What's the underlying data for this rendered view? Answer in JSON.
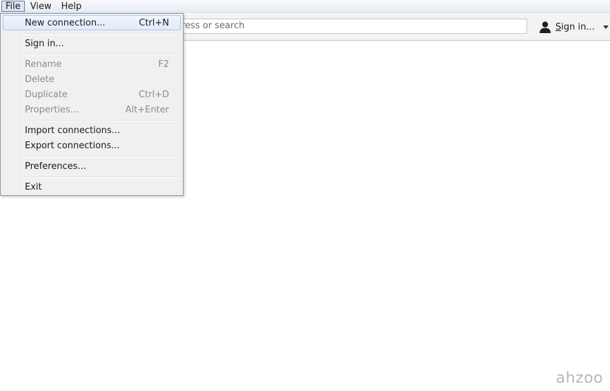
{
  "menubar": {
    "items": [
      {
        "label": "File"
      },
      {
        "label": "View"
      },
      {
        "label": "Help"
      }
    ]
  },
  "toolbar": {
    "address_placeholder": "Enter address or search",
    "address_visible_text": "ress or search",
    "signin_label": "Sign in...",
    "signin_underline": "S",
    "signin_rest": "ign in..."
  },
  "file_menu": {
    "items": [
      {
        "label": "New connection...",
        "shortcut": "Ctrl+N",
        "enabled": true,
        "highlighted": true
      },
      {
        "label": "Sign in...",
        "shortcut": "",
        "enabled": true
      },
      {
        "label": "Rename",
        "shortcut": "F2",
        "enabled": false
      },
      {
        "label": "Delete",
        "shortcut": "",
        "enabled": false
      },
      {
        "label": "Duplicate",
        "shortcut": "Ctrl+D",
        "enabled": false
      },
      {
        "label": "Properties...",
        "shortcut": "Alt+Enter",
        "enabled": false
      },
      {
        "label": "Import connections...",
        "shortcut": "",
        "enabled": true
      },
      {
        "label": "Export connections...",
        "shortcut": "",
        "enabled": true
      },
      {
        "label": "Preferences...",
        "shortcut": "",
        "enabled": true
      },
      {
        "label": "Exit",
        "shortcut": "",
        "enabled": true
      }
    ]
  },
  "watermark": "ahzoo",
  "colors": {
    "menu_highlight": "#dce6f4",
    "menu_background": "#f0f0f0",
    "disabled_text": "#8c8c8c"
  }
}
